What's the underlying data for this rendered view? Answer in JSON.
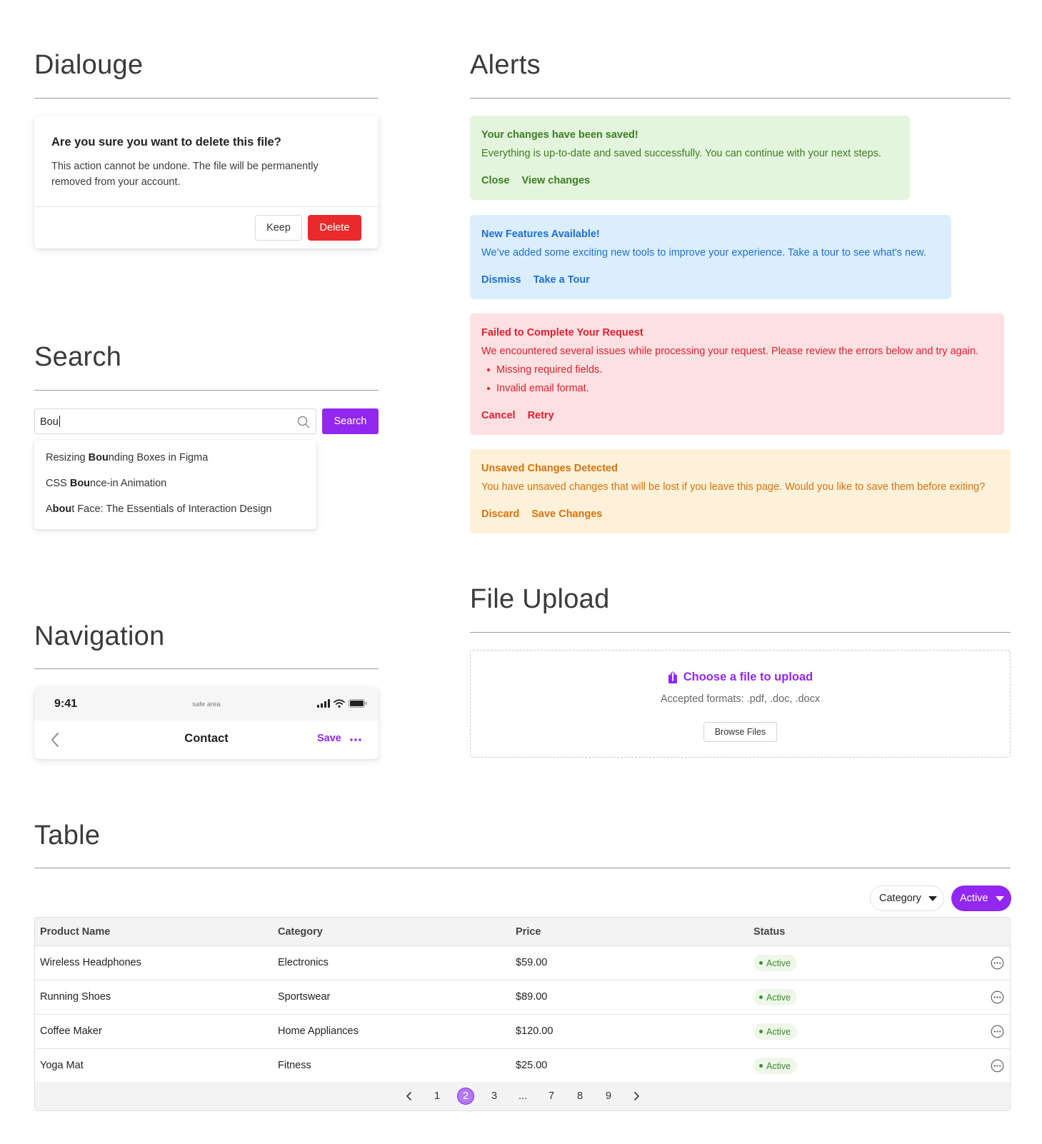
{
  "sections": {
    "dialog": "Dialouge",
    "alerts": "Alerts",
    "search": "Search",
    "navigation": "Navigation",
    "file_upload": "File Upload",
    "table": "Table"
  },
  "dialog": {
    "title": "Are you sure you want to delete this file?",
    "body": "This action cannot be undone. The file will be permanently removed from your account.",
    "keep_label": "Keep",
    "delete_label": "Delete",
    "delete_color": "#ea2a2a"
  },
  "search": {
    "value": "Bou",
    "icon": "search-icon",
    "button_label": "Search",
    "suggestions": [
      {
        "pre": "Resizing ",
        "match": "Bou",
        "post": "nding Boxes in Figma"
      },
      {
        "pre": "CSS ",
        "match": "Bou",
        "post": "nce-in Animation"
      },
      {
        "pre": "A",
        "match": "bou",
        "post": "t Face: The Essentials of Interaction Design"
      }
    ]
  },
  "navigation": {
    "time": "9:41",
    "safe_area": "safe area",
    "title": "Contact",
    "save_label": "Save",
    "back_icon": "chevron-left-icon",
    "more_icon": "more-horizontal-icon"
  },
  "alerts": {
    "success": {
      "title": "Your changes have been saved!",
      "body": "Everything is up-to-date and saved successfully. You can continue with your next steps.",
      "actions": [
        "Close",
        "View changes"
      ],
      "bg": "#e3f5dc",
      "color": "#3b7d22"
    },
    "info": {
      "title": "New Features Available!",
      "body": "We’ve added some exciting new tools to improve your experience. Take a tour to see what's new.",
      "actions": [
        "Dismiss",
        "Take a Tour"
      ],
      "bg": "#dbeefe",
      "color": "#1f6fd1"
    },
    "error": {
      "title": "Failed to Complete Your Request",
      "body": "We encountered several issues while processing your request. Please review the errors below and try again.",
      "errors": [
        "Missing required fields.",
        "Invalid email format."
      ],
      "actions": [
        "Cancel",
        "Retry"
      ],
      "bg": "#fde0e2",
      "color": "#e0202f"
    },
    "warning": {
      "title": "Unsaved Changes Detected",
      "body": "You have unsaved changes that will be lost if you leave this page. Would you like to save them before exiting?",
      "actions": [
        "Discard",
        "Save Changes"
      ],
      "bg": "#fdf1d9",
      "color": "#d9720c"
    }
  },
  "upload": {
    "title": "Choose a file to upload",
    "formats": "Accepted formats: .pdf, .doc, .docx",
    "browse_label": "Browse Files",
    "icon": "upload-icon"
  },
  "table": {
    "filters": {
      "category": "Category",
      "status": "Active"
    },
    "columns": [
      "Product Name",
      "Category",
      "Price",
      "Status"
    ],
    "rows": [
      {
        "name": "Wireless Headphones",
        "category": "Electronics",
        "price": "$59.00",
        "status": "Active"
      },
      {
        "name": "Running Shoes",
        "category": "Sportswear",
        "price": "$89.00",
        "status": "Active"
      },
      {
        "name": "Coffee Maker",
        "category": "Home Appliances",
        "price": "$120.00",
        "status": "Active"
      },
      {
        "name": "Yoga Mat",
        "category": "Fitness",
        "price": "$25.00",
        "status": "Active"
      }
    ],
    "pagination": {
      "pages": [
        "1",
        "2",
        "3",
        "...",
        "7",
        "8",
        "9"
      ],
      "current": "2"
    }
  },
  "colors": {
    "accent": "#9228f0",
    "success": "#3b8c2a"
  }
}
